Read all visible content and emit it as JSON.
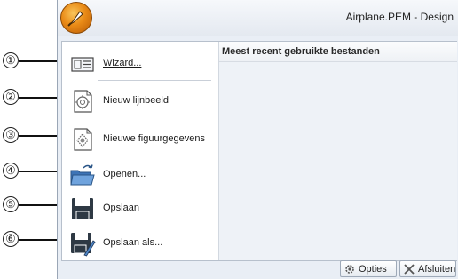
{
  "window": {
    "title": "Airplane.PEM - Design"
  },
  "callouts": [
    "①",
    "②",
    "③",
    "④",
    "⑤",
    "⑥"
  ],
  "menu": {
    "items": [
      {
        "label": "Wizard...",
        "icon": "wizard-icon"
      },
      {
        "label": "Nieuw lijnbeeld",
        "icon": "new-line-image-icon"
      },
      {
        "label": "Nieuwe figuurgegevens",
        "icon": "new-figure-data-icon"
      },
      {
        "label": "Openen...",
        "icon": "open-folder-icon"
      },
      {
        "label": "Opslaan",
        "icon": "save-icon"
      },
      {
        "label": "Opslaan als...",
        "icon": "save-as-icon"
      }
    ]
  },
  "recent": {
    "header": "Meest recent gebruikte bestanden"
  },
  "footer": {
    "options_label": "Opties",
    "exit_label": "Afsluiten"
  },
  "colors": {
    "accent": "#e98a16",
    "folder": "#4f86c6"
  }
}
